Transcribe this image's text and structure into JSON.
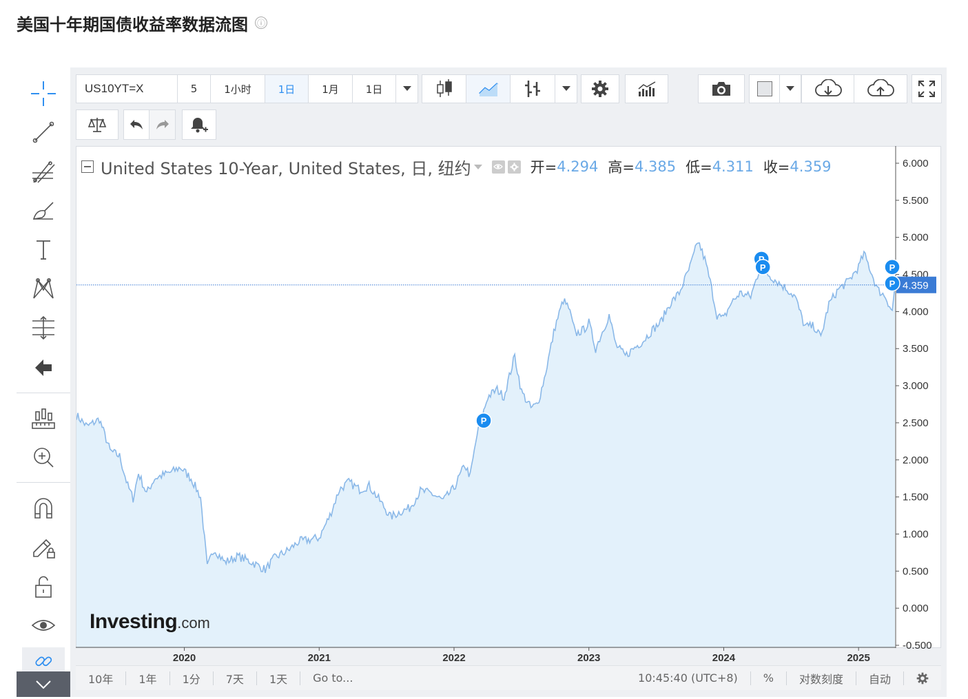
{
  "page": {
    "title": "美国十年期国债收益率数据流图",
    "info_icon": "ⓘ"
  },
  "toolbar_top": {
    "symbol": "US10YT=X",
    "intervals": [
      "5",
      "1小时",
      "1日",
      "1月",
      "1日"
    ],
    "active_interval_index": 2
  },
  "toolbar_icons": {
    "top_right": [
      "candlestick-icon",
      "line-chart-icon",
      "bar-chart-icon",
      "settings-icon",
      "indicators-icon",
      "camera-icon",
      "color-box-icon",
      "cloud-download-icon",
      "cloud-upload-icon",
      "fullscreen-icon"
    ],
    "second_row": [
      "compare-scale-icon",
      "undo-icon",
      "redo-icon",
      "alert-bell-icon"
    ]
  },
  "legend": {
    "name": "United States 10-Year, United States, 日, 纽约",
    "open_label": "开=",
    "open": "4.294",
    "high_label": "高=",
    "high": "4.385",
    "low_label": "低=",
    "low": "4.311",
    "close_label": "收=",
    "close": "4.359"
  },
  "watermark": {
    "brand": "Investing",
    "suffix": ".com"
  },
  "left_tools": [
    "crosshair-icon",
    "trend-line-icon",
    "fibonacci-icon",
    "brush-icon",
    "text-icon",
    "pattern-icon",
    "gann-icon",
    "back-arrow-icon",
    "measure-icon",
    "zoom-in-icon",
    "magnet-icon",
    "lock-edit-icon",
    "unlock-icon",
    "eye-icon",
    "link-icon",
    "collapse-chevron-icon"
  ],
  "bottom_bar": {
    "ranges": [
      "10年",
      "1年",
      "1分",
      "7天",
      "1天",
      "Go to..."
    ],
    "time": "10:45:40 (UTC+8)",
    "percent": "%",
    "log_scale": "对数刻度",
    "auto": "自动",
    "settings_icon": "gear-icon"
  },
  "colors": {
    "line": "#8ab8e8",
    "area": "#e3f1fb",
    "accent": "#2f8ff0",
    "price_tag": "#3a7bd5",
    "marker": "#1a8cf0"
  },
  "chart_data": {
    "type": "area",
    "title": "",
    "xlabel": "",
    "ylabel": "",
    "ylim": [
      -0.5,
      6.0
    ],
    "y_ticks": [
      "6.000",
      "5.500",
      "5.000",
      "4.500",
      "4.000",
      "3.500",
      "3.000",
      "2.500",
      "2.000",
      "1.500",
      "1.000",
      "0.500",
      "0.000",
      "-0.500"
    ],
    "x_ticks": [
      {
        "label": "2020",
        "t": 2020.0
      },
      {
        "label": "2021",
        "t": 2021.0
      },
      {
        "label": "2022",
        "t": 2022.0
      },
      {
        "label": "2023",
        "t": 2023.0
      },
      {
        "label": "2024",
        "t": 2024.0
      },
      {
        "label": "2025",
        "t": 2025.0
      }
    ],
    "x_range": [
      2019.2,
      2025.27
    ],
    "current_price": "4.359",
    "current_value": 4.359,
    "markers": [
      {
        "label": "P",
        "t": 2022.22,
        "y": 2.53
      },
      {
        "label": "P",
        "t": 2024.28,
        "y": 4.71
      },
      {
        "label": "P",
        "t": 2024.29,
        "y": 4.6
      },
      {
        "label": "P",
        "t": 2025.25,
        "y": 4.6
      },
      {
        "label": "P",
        "t": 2025.25,
        "y": 4.38
      }
    ],
    "series": [
      {
        "points": [
          [
            2019.2,
            2.6
          ],
          [
            2019.28,
            2.45
          ],
          [
            2019.37,
            2.55
          ],
          [
            2019.45,
            2.12
          ],
          [
            2019.52,
            2.05
          ],
          [
            2019.58,
            1.65
          ],
          [
            2019.62,
            1.48
          ],
          [
            2019.66,
            1.82
          ],
          [
            2019.72,
            1.55
          ],
          [
            2019.78,
            1.75
          ],
          [
            2019.85,
            1.8
          ],
          [
            2019.92,
            1.85
          ],
          [
            2019.97,
            1.9
          ],
          [
            2020.05,
            1.75
          ],
          [
            2020.12,
            1.5
          ],
          [
            2020.17,
            0.55
          ],
          [
            2020.22,
            0.8
          ],
          [
            2020.3,
            0.62
          ],
          [
            2020.4,
            0.7
          ],
          [
            2020.5,
            0.62
          ],
          [
            2020.6,
            0.52
          ],
          [
            2020.67,
            0.68
          ],
          [
            2020.77,
            0.78
          ],
          [
            2020.85,
            0.9
          ],
          [
            2020.92,
            0.92
          ],
          [
            2021.0,
            0.95
          ],
          [
            2021.08,
            1.25
          ],
          [
            2021.15,
            1.6
          ],
          [
            2021.22,
            1.7
          ],
          [
            2021.3,
            1.6
          ],
          [
            2021.37,
            1.65
          ],
          [
            2021.45,
            1.45
          ],
          [
            2021.53,
            1.23
          ],
          [
            2021.6,
            1.3
          ],
          [
            2021.67,
            1.35
          ],
          [
            2021.75,
            1.58
          ],
          [
            2021.83,
            1.55
          ],
          [
            2021.92,
            1.45
          ],
          [
            2022.0,
            1.62
          ],
          [
            2022.08,
            1.93
          ],
          [
            2022.12,
            1.78
          ],
          [
            2022.17,
            2.33
          ],
          [
            2022.25,
            2.85
          ],
          [
            2022.32,
            2.95
          ],
          [
            2022.37,
            2.85
          ],
          [
            2022.45,
            3.4
          ],
          [
            2022.5,
            2.92
          ],
          [
            2022.57,
            2.7
          ],
          [
            2022.62,
            2.75
          ],
          [
            2022.67,
            3.1
          ],
          [
            2022.75,
            3.8
          ],
          [
            2022.81,
            4.15
          ],
          [
            2022.85,
            4.05
          ],
          [
            2022.9,
            3.7
          ],
          [
            2022.96,
            3.75
          ],
          [
            2023.0,
            3.85
          ],
          [
            2023.05,
            3.5
          ],
          [
            2023.15,
            3.95
          ],
          [
            2023.2,
            3.55
          ],
          [
            2023.27,
            3.4
          ],
          [
            2023.33,
            3.5
          ],
          [
            2023.4,
            3.6
          ],
          [
            2023.47,
            3.75
          ],
          [
            2023.53,
            3.85
          ],
          [
            2023.6,
            4.1
          ],
          [
            2023.67,
            4.25
          ],
          [
            2023.75,
            4.6
          ],
          [
            2023.81,
            4.95
          ],
          [
            2023.86,
            4.7
          ],
          [
            2023.9,
            4.4
          ],
          [
            2023.95,
            3.95
          ],
          [
            2024.0,
            3.9
          ],
          [
            2024.05,
            4.1
          ],
          [
            2024.12,
            4.25
          ],
          [
            2024.2,
            4.2
          ],
          [
            2024.28,
            4.65
          ],
          [
            2024.33,
            4.5
          ],
          [
            2024.4,
            4.4
          ],
          [
            2024.47,
            4.3
          ],
          [
            2024.53,
            4.2
          ],
          [
            2024.6,
            3.8
          ],
          [
            2024.67,
            3.8
          ],
          [
            2024.72,
            3.65
          ],
          [
            2024.78,
            4.1
          ],
          [
            2024.85,
            4.3
          ],
          [
            2024.92,
            4.4
          ],
          [
            2025.0,
            4.6
          ],
          [
            2025.04,
            4.78
          ],
          [
            2025.08,
            4.6
          ],
          [
            2025.14,
            4.3
          ],
          [
            2025.2,
            4.2
          ],
          [
            2025.25,
            4.0
          ],
          [
            2025.27,
            4.36
          ]
        ]
      }
    ]
  }
}
